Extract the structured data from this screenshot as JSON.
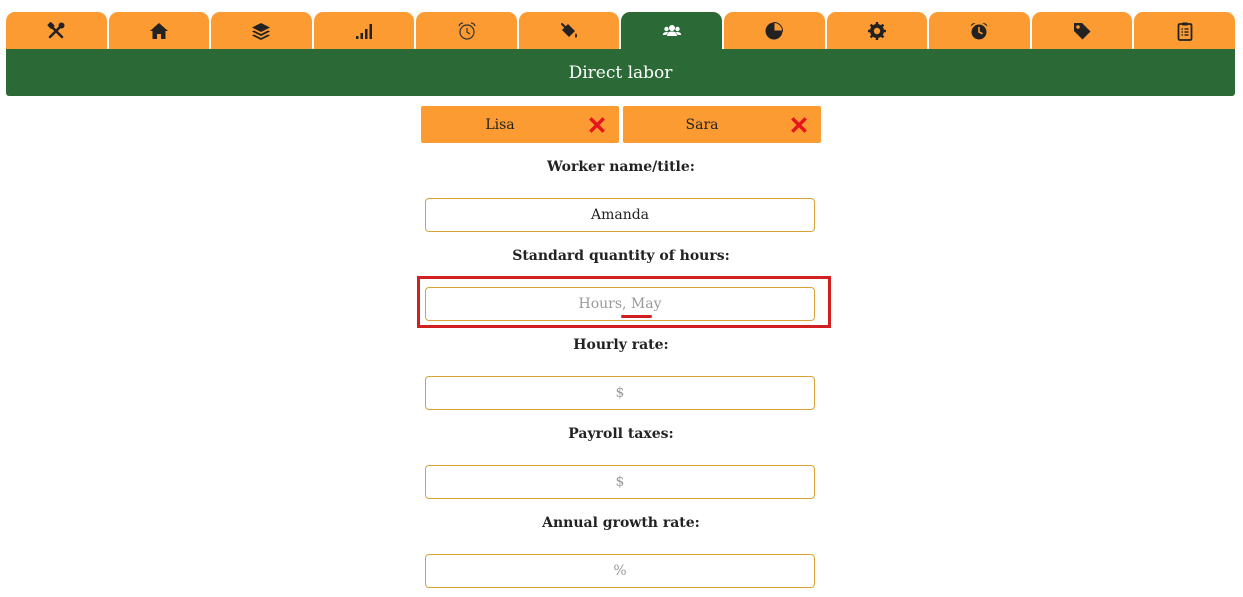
{
  "tabs": [
    {
      "icon": "tools-icon",
      "active": false
    },
    {
      "icon": "home-icon",
      "active": false
    },
    {
      "icon": "layers-icon",
      "active": false
    },
    {
      "icon": "signal-bars-icon",
      "active": false
    },
    {
      "icon": "alarm-clock-outline-icon",
      "active": false
    },
    {
      "icon": "paint-bucket-icon",
      "active": false
    },
    {
      "icon": "users-icon",
      "active": true
    },
    {
      "icon": "pie-chart-icon",
      "active": false
    },
    {
      "icon": "gear-badge-icon",
      "active": false
    },
    {
      "icon": "alarm-clock-icon",
      "active": false
    },
    {
      "icon": "tag-icon",
      "active": false
    },
    {
      "icon": "clipboard-icon",
      "active": false
    }
  ],
  "colors": {
    "accent": "#fd9b33",
    "primary": "#2b6a36",
    "remove": "#e8141d",
    "highlight": "#d21f1f"
  },
  "header": {
    "title": "Direct labor"
  },
  "workers": [
    {
      "name": "Lisa"
    },
    {
      "name": "Sara"
    }
  ],
  "form": {
    "name_label": "Worker name/title:",
    "name_value": "Amanda",
    "hours_label": "Standard quantity of hours:",
    "hours_placeholder": "Hours, May",
    "rate_label": "Hourly rate:",
    "rate_placeholder": "$",
    "taxes_label": "Payroll taxes:",
    "taxes_placeholder": "$",
    "growth_label": "Annual growth rate:",
    "growth_placeholder": "%"
  }
}
